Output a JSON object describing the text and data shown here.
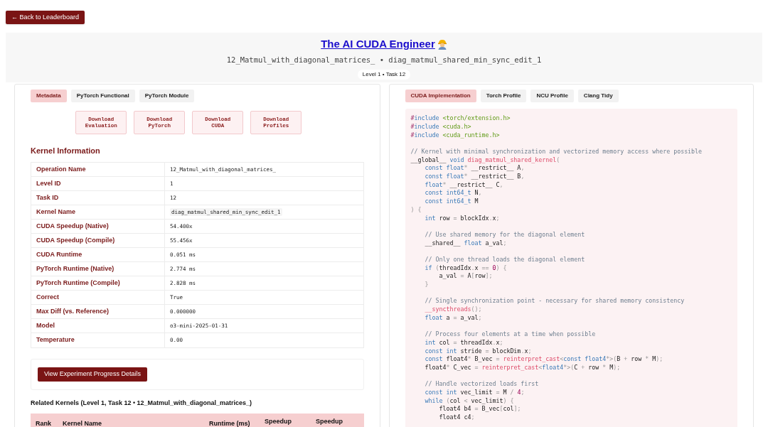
{
  "back_button": "← Back to Leaderboard",
  "header": {
    "title": "The AI CUDA Engineer",
    "subtitle": "12_Matmul_with_diagonal_matrices_ • diag_matmul_shared_min_sync_edit_1",
    "badge": "Level 1 • Task 12"
  },
  "left_tabs": [
    {
      "label": "Metadata",
      "selected": true
    },
    {
      "label": "PyTorch Functional",
      "selected": false
    },
    {
      "label": "PyTorch Module",
      "selected": false
    }
  ],
  "downloads": [
    "Download Evaluation",
    "Download PyTorch",
    "Download CUDA",
    "Download Profiles"
  ],
  "kernel_info": {
    "heading": "Kernel Information",
    "rows": [
      {
        "label": "Operation Name",
        "value": "12_Matmul_with_diagonal_matrices_",
        "kind": "plain"
      },
      {
        "label": "Level ID",
        "value": "1",
        "kind": "plain"
      },
      {
        "label": "Task ID",
        "value": "12",
        "kind": "plain"
      },
      {
        "label": "Kernel Name",
        "value": "diag_matmul_shared_min_sync_edit_1",
        "kind": "chip"
      },
      {
        "label": "CUDA Speedup (Native)",
        "value": "54.400x",
        "kind": "plain"
      },
      {
        "label": "CUDA Speedup (Compile)",
        "value": "55.456x",
        "kind": "plain"
      },
      {
        "label": "CUDA Runtime",
        "value": "0.051 ms",
        "kind": "plain"
      },
      {
        "label": "PyTorch Runtime (Native)",
        "value": "2.774 ms",
        "kind": "plain"
      },
      {
        "label": "PyTorch Runtime (Compile)",
        "value": "2.828 ms",
        "kind": "plain"
      },
      {
        "label": "Correct",
        "value": "True",
        "kind": "plain"
      },
      {
        "label": "Max Diff (vs. Reference)",
        "value": "0.000000",
        "kind": "plain"
      },
      {
        "label": "Model",
        "value": "o3-mini-2025-01-31",
        "kind": "plain"
      },
      {
        "label": "Temperature",
        "value": "0.00",
        "kind": "plain"
      }
    ]
  },
  "progress_button": "View Experiment Progress Details",
  "related": {
    "heading": "Related Kernels (Level 1, Task 12 • 12_Matmul_with_diagonal_matrices_)",
    "columns": [
      "Rank",
      "Kernel Name",
      "Runtime (ms)",
      "Speedup",
      "Speedup"
    ]
  },
  "right_tabs": [
    {
      "label": "CUDA Implementation",
      "selected": true
    },
    {
      "label": "Torch Profile",
      "selected": false
    },
    {
      "label": "NCU Profile",
      "selected": false
    },
    {
      "label": "Clang Tidy",
      "selected": false
    }
  ],
  "code_lines": [
    {
      "kind": "code",
      "tokens": [
        {
          "kind": "pre",
          "text": "#"
        },
        {
          "kind": "kw",
          "text": "include "
        },
        {
          "kind": "str",
          "text": "<torch/extension.h>"
        }
      ]
    },
    {
      "kind": "code",
      "tokens": [
        {
          "kind": "pre",
          "text": "#"
        },
        {
          "kind": "kw",
          "text": "include "
        },
        {
          "kind": "str",
          "text": "<cuda.h>"
        }
      ]
    },
    {
      "kind": "code",
      "tokens": [
        {
          "kind": "pre",
          "text": "#"
        },
        {
          "kind": "kw",
          "text": "include "
        },
        {
          "kind": "str",
          "text": "<cuda_runtime.h>"
        }
      ]
    },
    {
      "kind": "blank"
    },
    {
      "kind": "code",
      "tokens": [
        {
          "kind": "cm",
          "text": "// Kernel with minimal synchronization and vectorized memory access where possible"
        }
      ]
    },
    {
      "kind": "code",
      "tokens": [
        {
          "kind": "txt",
          "text": "__global__ "
        },
        {
          "kind": "kw",
          "text": "void "
        },
        {
          "kind": "fn",
          "text": "diag_matmul_shared_kernel"
        },
        {
          "kind": "pun",
          "text": "("
        }
      ]
    },
    {
      "kind": "code",
      "tokens": [
        {
          "kind": "kw",
          "text": "    const float"
        },
        {
          "kind": "pun",
          "text": "*"
        },
        {
          "kind": "txt",
          "text": " __restrict__ A"
        },
        {
          "kind": "pun",
          "text": ","
        }
      ]
    },
    {
      "kind": "code",
      "tokens": [
        {
          "kind": "kw",
          "text": "    const float"
        },
        {
          "kind": "pun",
          "text": "*"
        },
        {
          "kind": "txt",
          "text": " __restrict__ B"
        },
        {
          "kind": "pun",
          "text": ","
        }
      ]
    },
    {
      "kind": "code",
      "tokens": [
        {
          "kind": "kw",
          "text": "    float"
        },
        {
          "kind": "pun",
          "text": "*"
        },
        {
          "kind": "txt",
          "text": " __restrict__ C"
        },
        {
          "kind": "pun",
          "text": ","
        }
      ]
    },
    {
      "kind": "code",
      "tokens": [
        {
          "kind": "kw",
          "text": "    const int64_t"
        },
        {
          "kind": "txt",
          "text": " N"
        },
        {
          "kind": "pun",
          "text": ","
        }
      ]
    },
    {
      "kind": "code",
      "tokens": [
        {
          "kind": "kw",
          "text": "    const int64_t"
        },
        {
          "kind": "txt",
          "text": " M"
        }
      ]
    },
    {
      "kind": "code",
      "tokens": [
        {
          "kind": "pun",
          "text": ") {"
        }
      ]
    },
    {
      "kind": "code",
      "tokens": [
        {
          "kind": "kw",
          "text": "    int"
        },
        {
          "kind": "txt",
          "text": " row "
        },
        {
          "kind": "pun",
          "text": "="
        },
        {
          "kind": "txt",
          "text": " blockIdx"
        },
        {
          "kind": "pun",
          "text": "."
        },
        {
          "kind": "txt",
          "text": "x"
        },
        {
          "kind": "pun",
          "text": ";"
        }
      ]
    },
    {
      "kind": "blank"
    },
    {
      "kind": "code",
      "tokens": [
        {
          "kind": "cm",
          "text": "    // Use shared memory for the diagonal element"
        }
      ]
    },
    {
      "kind": "code",
      "tokens": [
        {
          "kind": "txt",
          "text": "    __shared__ "
        },
        {
          "kind": "kw",
          "text": "float"
        },
        {
          "kind": "txt",
          "text": " a_val"
        },
        {
          "kind": "pun",
          "text": ";"
        }
      ]
    },
    {
      "kind": "blank"
    },
    {
      "kind": "code",
      "tokens": [
        {
          "kind": "cm",
          "text": "    // Only one thread loads the diagonal element"
        }
      ]
    },
    {
      "kind": "code",
      "tokens": [
        {
          "kind": "kw",
          "text": "    if "
        },
        {
          "kind": "pun",
          "text": "("
        },
        {
          "kind": "txt",
          "text": "threadIdx"
        },
        {
          "kind": "pun",
          "text": "."
        },
        {
          "kind": "txt",
          "text": "x "
        },
        {
          "kind": "pun",
          "text": "== "
        },
        {
          "kind": "num",
          "text": "0"
        },
        {
          "kind": "pun",
          "text": ") {"
        }
      ]
    },
    {
      "kind": "code",
      "tokens": [
        {
          "kind": "txt",
          "text": "        a_val "
        },
        {
          "kind": "pun",
          "text": "="
        },
        {
          "kind": "txt",
          "text": " A"
        },
        {
          "kind": "pun",
          "text": "["
        },
        {
          "kind": "txt",
          "text": "row"
        },
        {
          "kind": "pun",
          "text": "];"
        }
      ]
    },
    {
      "kind": "code",
      "tokens": [
        {
          "kind": "pun",
          "text": "    }"
        }
      ]
    },
    {
      "kind": "blank"
    },
    {
      "kind": "code",
      "tokens": [
        {
          "kind": "cm",
          "text": "    // Single synchronization point - necessary for shared memory consistency"
        }
      ]
    },
    {
      "kind": "code",
      "tokens": [
        {
          "kind": "fn",
          "text": "    __syncthreads"
        },
        {
          "kind": "pun",
          "text": "();"
        }
      ]
    },
    {
      "kind": "code",
      "tokens": [
        {
          "kind": "kw",
          "text": "    float"
        },
        {
          "kind": "txt",
          "text": " a "
        },
        {
          "kind": "pun",
          "text": "="
        },
        {
          "kind": "txt",
          "text": " a_val"
        },
        {
          "kind": "pun",
          "text": ";"
        }
      ]
    },
    {
      "kind": "blank"
    },
    {
      "kind": "code",
      "tokens": [
        {
          "kind": "cm",
          "text": "    // Process four elements at a time when possible"
        }
      ]
    },
    {
      "kind": "code",
      "tokens": [
        {
          "kind": "kw",
          "text": "    int"
        },
        {
          "kind": "txt",
          "text": " col "
        },
        {
          "kind": "pun",
          "text": "="
        },
        {
          "kind": "txt",
          "text": " threadIdx"
        },
        {
          "kind": "pun",
          "text": "."
        },
        {
          "kind": "txt",
          "text": "x"
        },
        {
          "kind": "pun",
          "text": ";"
        }
      ]
    },
    {
      "kind": "code",
      "tokens": [
        {
          "kind": "kw",
          "text": "    const int"
        },
        {
          "kind": "txt",
          "text": " stride "
        },
        {
          "kind": "pun",
          "text": "="
        },
        {
          "kind": "txt",
          "text": " blockDim"
        },
        {
          "kind": "pun",
          "text": "."
        },
        {
          "kind": "txt",
          "text": "x"
        },
        {
          "kind": "pun",
          "text": ";"
        }
      ]
    },
    {
      "kind": "code",
      "tokens": [
        {
          "kind": "kw",
          "text": "    const"
        },
        {
          "kind": "txt",
          "text": " float4"
        },
        {
          "kind": "pun",
          "text": "*"
        },
        {
          "kind": "txt",
          "text": " B_vec "
        },
        {
          "kind": "pun",
          "text": "= "
        },
        {
          "kind": "fn",
          "text": "reinterpret_cast"
        },
        {
          "kind": "pun",
          "text": "<"
        },
        {
          "kind": "kw",
          "text": "const float4"
        },
        {
          "kind": "pun",
          "text": "*>("
        },
        {
          "kind": "txt",
          "text": "B "
        },
        {
          "kind": "pun",
          "text": "+"
        },
        {
          "kind": "txt",
          "text": " row "
        },
        {
          "kind": "pun",
          "text": "*"
        },
        {
          "kind": "txt",
          "text": " M"
        },
        {
          "kind": "pun",
          "text": ");"
        }
      ]
    },
    {
      "kind": "code",
      "tokens": [
        {
          "kind": "txt",
          "text": "    float4"
        },
        {
          "kind": "pun",
          "text": "*"
        },
        {
          "kind": "txt",
          "text": " C_vec "
        },
        {
          "kind": "pun",
          "text": "= "
        },
        {
          "kind": "fn",
          "text": "reinterpret_cast"
        },
        {
          "kind": "pun",
          "text": "<"
        },
        {
          "kind": "kw",
          "text": "float4"
        },
        {
          "kind": "pun",
          "text": "*>("
        },
        {
          "kind": "txt",
          "text": "C "
        },
        {
          "kind": "pun",
          "text": "+"
        },
        {
          "kind": "txt",
          "text": " row "
        },
        {
          "kind": "pun",
          "text": "*"
        },
        {
          "kind": "txt",
          "text": " M"
        },
        {
          "kind": "pun",
          "text": ");"
        }
      ]
    },
    {
      "kind": "blank"
    },
    {
      "kind": "code",
      "tokens": [
        {
          "kind": "cm",
          "text": "    // Handle vectorized loads first"
        }
      ]
    },
    {
      "kind": "code",
      "tokens": [
        {
          "kind": "kw",
          "text": "    const int"
        },
        {
          "kind": "txt",
          "text": " vec_limit "
        },
        {
          "kind": "pun",
          "text": "="
        },
        {
          "kind": "txt",
          "text": " M "
        },
        {
          "kind": "pun",
          "text": "/ "
        },
        {
          "kind": "num",
          "text": "4"
        },
        {
          "kind": "pun",
          "text": ";"
        }
      ]
    },
    {
      "kind": "code",
      "tokens": [
        {
          "kind": "kw",
          "text": "    while "
        },
        {
          "kind": "pun",
          "text": "("
        },
        {
          "kind": "txt",
          "text": "col "
        },
        {
          "kind": "pun",
          "text": "<"
        },
        {
          "kind": "txt",
          "text": " vec_limit"
        },
        {
          "kind": "pun",
          "text": ") {"
        }
      ]
    },
    {
      "kind": "code",
      "tokens": [
        {
          "kind": "txt",
          "text": "        float4 b4 "
        },
        {
          "kind": "pun",
          "text": "="
        },
        {
          "kind": "txt",
          "text": " B_vec"
        },
        {
          "kind": "pun",
          "text": "["
        },
        {
          "kind": "txt",
          "text": "col"
        },
        {
          "kind": "pun",
          "text": "];"
        }
      ]
    },
    {
      "kind": "code",
      "tokens": [
        {
          "kind": "txt",
          "text": "        float4 c4"
        },
        {
          "kind": "pun",
          "text": ";"
        }
      ]
    }
  ]
}
